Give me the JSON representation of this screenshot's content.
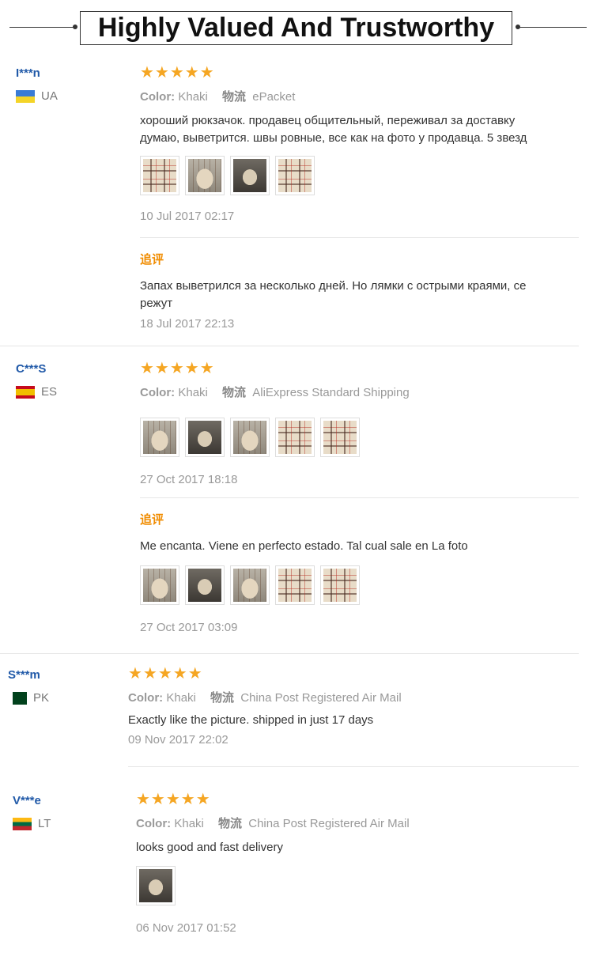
{
  "header": {
    "title": "Highly Valued And Trustworthy"
  },
  "labels": {
    "color": "Color:",
    "shipping": "物流",
    "additional": "追评"
  },
  "colors": {
    "star": "#f5a623",
    "username": "#2059a8",
    "additional_label": "#f08c00"
  },
  "reviews": [
    {
      "user": "I***n",
      "country": "UA",
      "stars": "★★★★★",
      "color": "Khaki",
      "shipping": "ePacket",
      "text_lines": [
        "хороший рюкзачок. продавец общительный, переживал за доставку",
        "думаю, выветрится. швы ровные, все как на фото у продавца. 5 звезд"
      ],
      "photos": [
        "plaid-bag",
        "backpack-front",
        "backpack-side",
        "plaid-closeup"
      ],
      "date": "10 Jul 2017 02:17",
      "additional": {
        "text_lines": [
          "Запах выветрился за несколько дней. Но лямки с острыми краями, се",
          "режут"
        ],
        "date": "18 Jul 2017 22:13"
      }
    },
    {
      "user": "C***S",
      "country": "ES",
      "stars": "★★★★★",
      "color": "Khaki",
      "shipping": "AliExpress Standard Shipping",
      "photos": [
        "backpack-front",
        "backpack-open",
        "backpack-back",
        "plaid-lining",
        "plaid-closeup"
      ],
      "date": "27 Oct 2017 18:18",
      "additional": {
        "text": "Me encanta. Viene en perfecto estado. Tal cual sale en La foto",
        "photos": [
          "backpack-front",
          "backpack-open",
          "backpack-back",
          "plaid-lining",
          "plaid-closeup"
        ],
        "date": "27 Oct 2017 03:09"
      }
    },
    {
      "user": "S***m",
      "country": "PK",
      "stars": "★★★★★",
      "color": "Khaki",
      "shipping": "China Post Registered Air Mail",
      "text": "Exactly like the picture. shipped in just 17 days",
      "date": "09 Nov 2017 22:02"
    },
    {
      "user": "V***e",
      "country": "LT",
      "stars": "★★★★★",
      "color": "Khaki",
      "shipping": "China Post Registered Air Mail",
      "text": "looks good and fast delivery",
      "photos": [
        "backpack-dark"
      ],
      "date": "06 Nov 2017 01:52"
    }
  ]
}
